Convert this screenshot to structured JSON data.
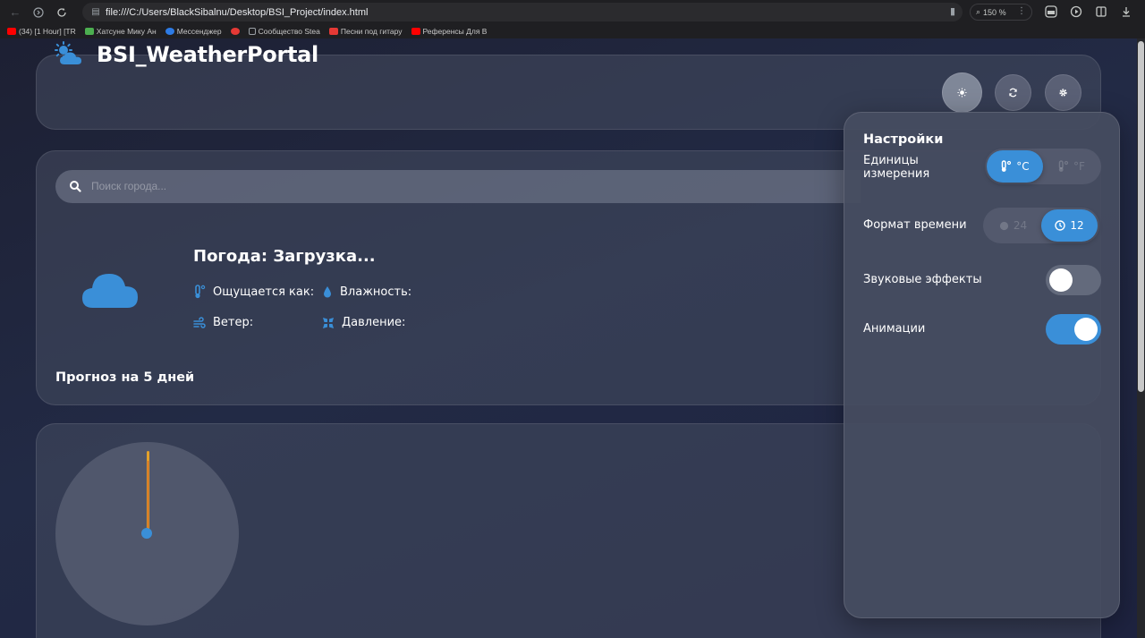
{
  "browser": {
    "url": "file:///C:/Users/BlackSibalnu/Desktop/BSI_Project/index.html",
    "zoom": "150 %",
    "bookmarks": [
      {
        "label": "(34) [1 Hour] [TR",
        "color": "#ff0000"
      },
      {
        "label": "Хатсуне Мику Ан",
        "color": "#4caf50"
      },
      {
        "label": "Мессенджер",
        "color": "#2d7be5"
      },
      {
        "label": "",
        "color": "#e53935"
      },
      {
        "label": "Сообщество Stea",
        "color": "#9aa0a6"
      },
      {
        "label": "Песни под гитару",
        "color": "#e53935"
      },
      {
        "label": "Референсы Для В",
        "color": "#ff0000"
      }
    ]
  },
  "header": {
    "title": "BSI_WeatherPortal"
  },
  "search": {
    "placeholder": "Поиск города..."
  },
  "weather": {
    "title": "Погода: Загрузка...",
    "feels_like_label": "Ощущается как:",
    "humidity_label": "Влажность:",
    "wind_label": "Ветер:",
    "pressure_label": "Давление:"
  },
  "forecast": {
    "title": "Прогноз на 5 дней"
  },
  "settings": {
    "title": "Настройки",
    "units_label_line1": "Единицы",
    "units_label_line2": "измерения",
    "unit_celsius": "°C",
    "unit_fahrenheit": "°F",
    "unit_selected": "celsius",
    "time_format_label": "Формат времени",
    "time_24": "24",
    "time_12": "12",
    "time_selected": "12",
    "sound_label": "Звуковые эффекты",
    "sound_enabled": false,
    "animations_label": "Анимации",
    "animations_enabled": true
  },
  "colors": {
    "accent": "#3a8fd8",
    "clock_hand": "#e3a12a"
  }
}
